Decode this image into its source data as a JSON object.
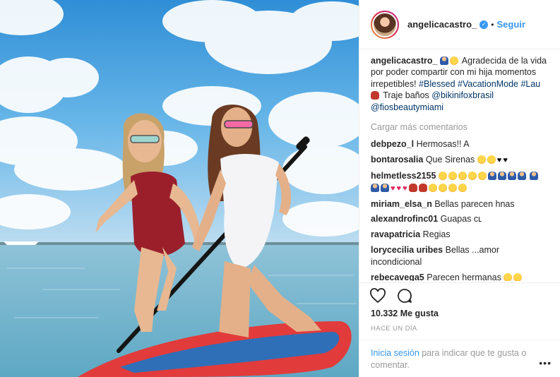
{
  "post": {
    "username": "angelicacastro_",
    "verified_icon": "verified-badge-icon",
    "separator": "•",
    "follow_label": "Seguir",
    "caption": {
      "username": "angelicacastro_",
      "text1": "Agradecida de la vida por poder compartir con mi hija momentos irrepetibles!",
      "tag1": "#Blessed",
      "tag2": "#VacationMode",
      "tag3": "#Lau",
      "text2": "Traje baños",
      "mention1": "@bikinifoxbrasil",
      "mention2": "@fiosbeautymiami"
    },
    "load_more": "Cargar más comentarios",
    "comments": [
      {
        "user": "debpezo_l",
        "text": "Hermosas!! A"
      },
      {
        "user": "bontarosalia",
        "text": "Que Sirenas"
      },
      {
        "user": "helmetless2155",
        "text": ""
      },
      {
        "user": "miriam_elsa_n",
        "text": "Bellas parecen hnas"
      },
      {
        "user": "alexandrofinc01",
        "text": "Guapas cʟ"
      },
      {
        "user": "ravapatricia",
        "text": "Regias"
      },
      {
        "user": "lorycecilia uribes",
        "text": "Bellas ...amor incondicional"
      },
      {
        "user": "rebecavega5",
        "text": "Parecen hermanas"
      }
    ],
    "likes": "10.332 Me gusta",
    "time_ago": "HACE UN DÍA",
    "login_link": "Inicia sesión",
    "login_text": "para indicar que te gusta o comentar.",
    "more_options": "•••"
  },
  "colors": {
    "accent": "#3897f0",
    "tag": "#003569",
    "muted": "#999999",
    "border": "#efefef"
  }
}
